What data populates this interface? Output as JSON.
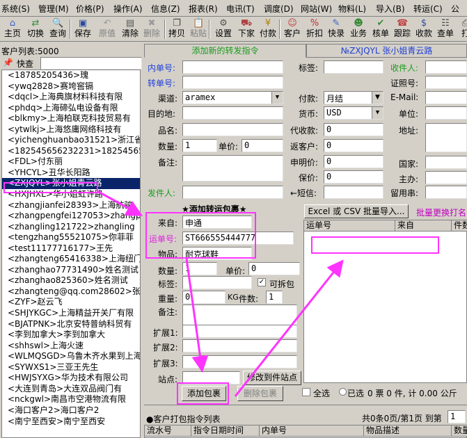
{
  "menubar": {
    "items": [
      "系统(S)",
      "管理(M)",
      "价格(P)",
      "操作(A)",
      "信息(Z)",
      "报表(R)",
      "电讯(T)",
      "调度(D)",
      "网站(W)",
      "物料(L)",
      "导入(B)",
      "转运(C)",
      "公"
    ]
  },
  "toolbar": {
    "items": [
      {
        "label": "主页",
        "icon": "home-icon",
        "glyph": "⌂",
        "color": "#3a62c4",
        "enabled": true
      },
      {
        "label": "切换",
        "icon": "switch-icon",
        "glyph": "⇄",
        "color": "#3a8a3a",
        "enabled": true
      },
      {
        "label": "查询",
        "icon": "search-icon",
        "glyph": "🔍",
        "color": "#444444",
        "enabled": true
      },
      {
        "label": "保存",
        "icon": "save-icon",
        "glyph": "▣",
        "color": "#2a4aa0",
        "enabled": true
      },
      {
        "label": "原值",
        "icon": "undo-icon",
        "glyph": "↶",
        "color": "#9a9a9a",
        "enabled": false
      },
      {
        "label": "清除",
        "icon": "clear-icon",
        "glyph": "▤",
        "color": "#555555",
        "enabled": true
      },
      {
        "label": "删除",
        "icon": "delete-icon",
        "glyph": "✖",
        "color": "#9a9a9a",
        "enabled": false
      },
      {
        "label": "拷贝",
        "icon": "copy-icon",
        "glyph": "❐",
        "color": "#444444",
        "enabled": true
      },
      {
        "label": "粘贴",
        "icon": "paste-icon",
        "glyph": "📋",
        "color": "#9a9a9a",
        "enabled": false
      },
      {
        "label": "设置",
        "icon": "settings-icon",
        "glyph": "⚙",
        "color": "#555555",
        "enabled": true
      },
      {
        "label": "下家",
        "icon": "next-party-icon",
        "glyph": "⛟",
        "color": "#b04040",
        "enabled": true
      },
      {
        "label": "付款",
        "icon": "payment-icon",
        "glyph": "¥",
        "color": "#b08000",
        "enabled": true
      },
      {
        "label": "客户",
        "icon": "customer-icon",
        "glyph": "☺",
        "color": "#c04040",
        "enabled": true
      },
      {
        "label": "折扣",
        "icon": "discount-icon",
        "glyph": "%",
        "color": "#c03030",
        "enabled": true
      },
      {
        "label": "快录",
        "icon": "quick-entry-icon",
        "glyph": "✎",
        "color": "#3a62c4",
        "enabled": true
      },
      {
        "label": "业务",
        "icon": "business-icon",
        "glyph": "☻",
        "color": "#3a8a3a",
        "enabled": true
      },
      {
        "label": "核单",
        "icon": "verify-icon",
        "glyph": "✔",
        "color": "#3a8a3a",
        "enabled": true
      },
      {
        "label": "跟踪",
        "icon": "track-icon",
        "glyph": "☎",
        "color": "#c04040",
        "enabled": true
      },
      {
        "label": "收款",
        "icon": "receive-icon",
        "glyph": "$",
        "color": "#2a4aa0",
        "enabled": true
      },
      {
        "label": "查单",
        "icon": "lookup-order-icon",
        "glyph": "☷",
        "color": "#444444",
        "enabled": true
      },
      {
        "label": "打",
        "icon": "print-icon",
        "glyph": "⎙",
        "color": "#444444",
        "enabled": true
      }
    ]
  },
  "left": {
    "header": "客户列表:5000",
    "fast_search_label": "快查",
    "customers": [
      "<18785205436>瑰",
      "<ywq2828>赛垮窖镉",
      "<dqcl>上海典旗材料科技有限",
      "<phdq>上海碲弘电设备有限",
      "<blkmy>上海柏联克科技贸易有",
      "<ytwlkj>上海悠庸网络科技有",
      "<yichenghuanbao31521>浙江省",
      "<182545656232231>18254565",
      "<FDL>付东丽",
      "<YHCYL>丑华长阳路",
      "<ZXJQYL>张小姐青云路",
      "<HXJHXL>华小姐虹许路",
      "<zhangjianfei28393>上海航骏",
      "<zhangpengfei127053>zhangp",
      "<zhangling121722>zhangling",
      "<tengzhang55521075>你菲菲",
      "<test11177716177>王先",
      "<zhangteng65416338>上海纽门",
      "<zhanghao77731490>姓名测试",
      "<zhanghao825360>姓名测试",
      "<zhangteng@qq.com28602>张腾",
      "<ZYF>赵云飞",
      "<SHJYKGC>上海精益开关厂有限",
      "<BJATPNK>北京安特普纳科贸有",
      "<李到加拿大>李到加拿大",
      "<shhswl>上海火速",
      "<WLMQSGD>乌鲁木齐水果到上海",
      "<SYWXS1>三亚王先生",
      "<HWJSYXG>华为技术有限公司",
      "<大连到青岛>大连双品阀门有",
      "<nckgwl>南昌市空港物流有限",
      "<海口客户2>海口客户2",
      "<南宁至西安>南宁至西安"
    ]
  },
  "tabs": {
    "active_label": "添加新的转发指令",
    "customer_label": "№ZXJQYL 张小姐青云路"
  },
  "form": {
    "inner_no_label": "内单号:",
    "inner_no_value": "",
    "tag_label": "标签:",
    "tag_value": "",
    "receiver_label": "收件人:",
    "receiver_value": "",
    "transfer_no_label": "转单号:",
    "transfer_no_value": "",
    "id_no_label": "证照号:",
    "id_no_value": "",
    "channel_label": "渠道:",
    "channel_value": "aramex",
    "payment_label": "付款:",
    "payment_value": "月结",
    "email_label": "E-Mail:",
    "email_value": "",
    "destination_label": "目的地:",
    "destination_value": "",
    "currency_label": "货币:",
    "currency_value": "USD",
    "unit_label": "单位:",
    "unit_value": "",
    "product_label": "品名:",
    "product_value": "",
    "cod_label": "代收款:",
    "cod_value": "0",
    "address_label": "地址:",
    "address_value": "",
    "qty_label": "数量:",
    "qty_value": "1",
    "unit_price_label": "单价:",
    "unit_price_value": "0",
    "rebate_label": "返客户:",
    "rebate_value": "0",
    "remark_label": "备注:",
    "remark_value": "",
    "declared_label": "申明价:",
    "declared_value": "0",
    "country_label": "国家:",
    "country_value": "",
    "insured_label": "保价:",
    "insured_value": "0",
    "province_label": "主办:",
    "province_value": "",
    "sender_label": "发件人:",
    "sender_value": "",
    "sms_label": "←短信:",
    "sms_value": "",
    "message_label": "留用串:",
    "message_value": ""
  },
  "package": {
    "section_title": "★添加转运包裹★",
    "from_label": "来自:",
    "from_value": "申通",
    "waybill_label": "运单号:",
    "waybill_value": "ST666555444777",
    "item_label": "物品:",
    "item_value": "耐克球鞋",
    "qty_label": "数量:",
    "qty_value": "1",
    "unit_price_label": "单价:",
    "unit_price_value": "0",
    "tag_label": "标签:",
    "tag_value": "",
    "splittable_label": "可拆包",
    "splittable_checked": true,
    "weight_label": "重量:",
    "weight_value": "0",
    "weight_unit": "KG",
    "pieces_label": "件数:",
    "pieces_value": "1",
    "remark_label": "备注:",
    "remark_value": "",
    "ext1_label": "扩展1:",
    "ext1_value": "",
    "ext2_label": "扩展2:",
    "ext2_value": "",
    "ext3_label": "扩展3:",
    "ext3_value": "",
    "station_label": "站点:",
    "station_value": "",
    "edit_station_button": "修改到件站点",
    "add_button": "添加包裹",
    "delete_button": "删除包裹"
  },
  "batch": {
    "import_button": "Excel 或 CSV 批量导入...",
    "replace_print_label": "批量更换打名",
    "columns": [
      "运单号",
      "来自",
      "件数"
    ],
    "select_all_label": "全选",
    "selected_label": "已选",
    "summary": "0 票 0 件, 计 0.00 公斤"
  },
  "bottom": {
    "title": "●客户打包指令列表",
    "pager": "共0条0页/第1页  到第",
    "page_input": "1",
    "columns": [
      "流水号",
      "指令日期时间",
      "内单号",
      "物品描述",
      "数量"
    ]
  },
  "colors": {
    "blue_label": "#1f3fd6",
    "green_label": "#1b9b1b",
    "annotation": "#ff33ff",
    "selection": "#0a246a"
  }
}
